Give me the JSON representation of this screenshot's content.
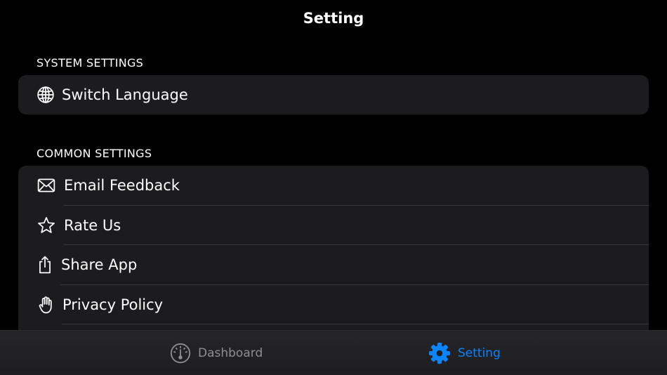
{
  "nav": {
    "title": "Setting"
  },
  "sections": {
    "system": {
      "header": "SYSTEM SETTINGS",
      "items": [
        {
          "label": "Switch Language",
          "icon": "globe-icon"
        }
      ]
    },
    "common": {
      "header": "COMMON SETTINGS",
      "items": [
        {
          "label": "Email Feedback",
          "icon": "envelope-icon"
        },
        {
          "label": "Rate Us",
          "icon": "star-icon"
        },
        {
          "label": "Share App",
          "icon": "share-icon"
        },
        {
          "label": "Privacy Policy",
          "icon": "hand-icon"
        }
      ]
    }
  },
  "tabbar": {
    "tabs": [
      {
        "label": "Dashboard",
        "icon": "gauge-icon",
        "selected": false
      },
      {
        "label": "Setting",
        "icon": "gear-icon",
        "selected": true
      }
    ]
  },
  "colors": {
    "background": "#000000",
    "group_bg": "#1c1c1e",
    "separator": "#38383a",
    "accent": "#0a84ff",
    "inactive_tab": "#8e8e93"
  }
}
